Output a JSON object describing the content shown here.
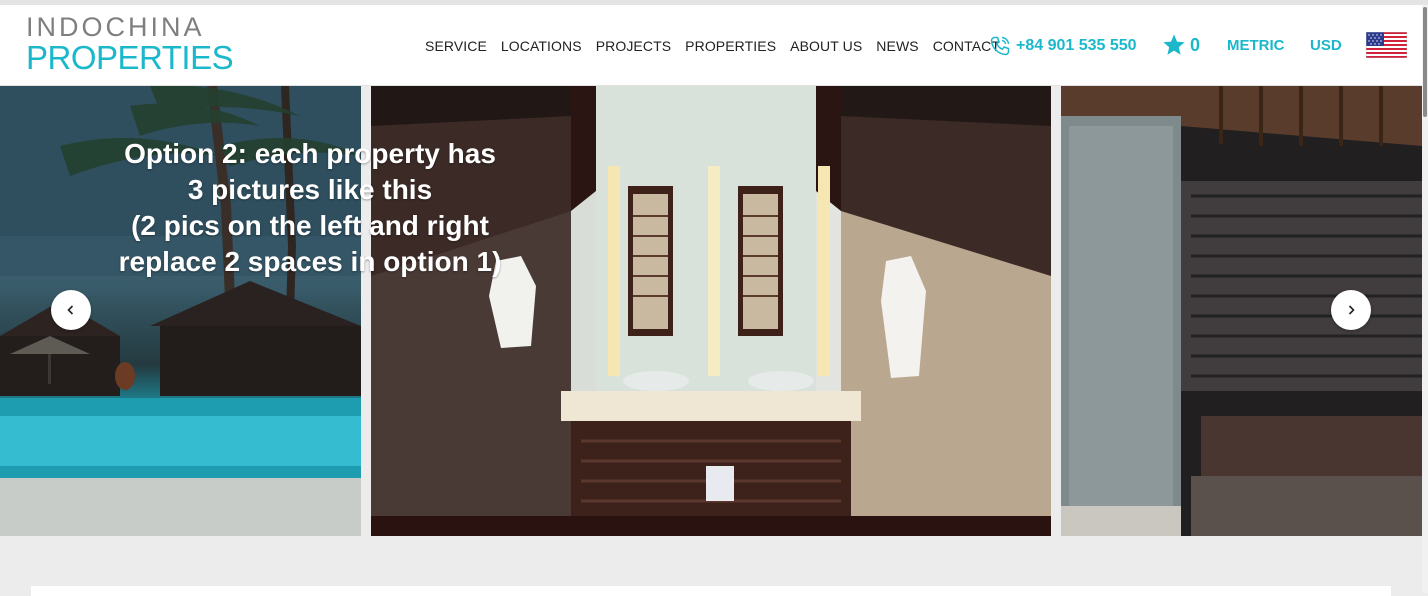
{
  "logo": {
    "line1": "INDOCHINA",
    "line2": "PROPERTIES"
  },
  "nav": {
    "items": [
      {
        "label": "SERVICE"
      },
      {
        "label": "LOCATIONS"
      },
      {
        "label": "PROJECTS"
      },
      {
        "label": "PROPERTIES"
      },
      {
        "label": "ABOUT US"
      },
      {
        "label": "NEWS"
      },
      {
        "label": "CONTACT"
      }
    ]
  },
  "header": {
    "phone": "+84 901 535 550",
    "favorites_count": "0",
    "unit": "METRIC",
    "currency": "USD",
    "phone_icon": "phone-icon",
    "star_icon": "star-icon",
    "flag_icon": "us-flag-icon"
  },
  "slider": {
    "overlay_lines": [
      "Option 2: each property has",
      "3 pictures like this",
      "(2 pics on the left and right",
      "replace 2 spaces in option 1)"
    ],
    "prev_icon": "chevron-left-icon",
    "next_icon": "chevron-right-icon"
  },
  "colors": {
    "accent": "#1bb8cc",
    "logo_gray": "#7f7f7f",
    "page_bg": "#ececec"
  }
}
